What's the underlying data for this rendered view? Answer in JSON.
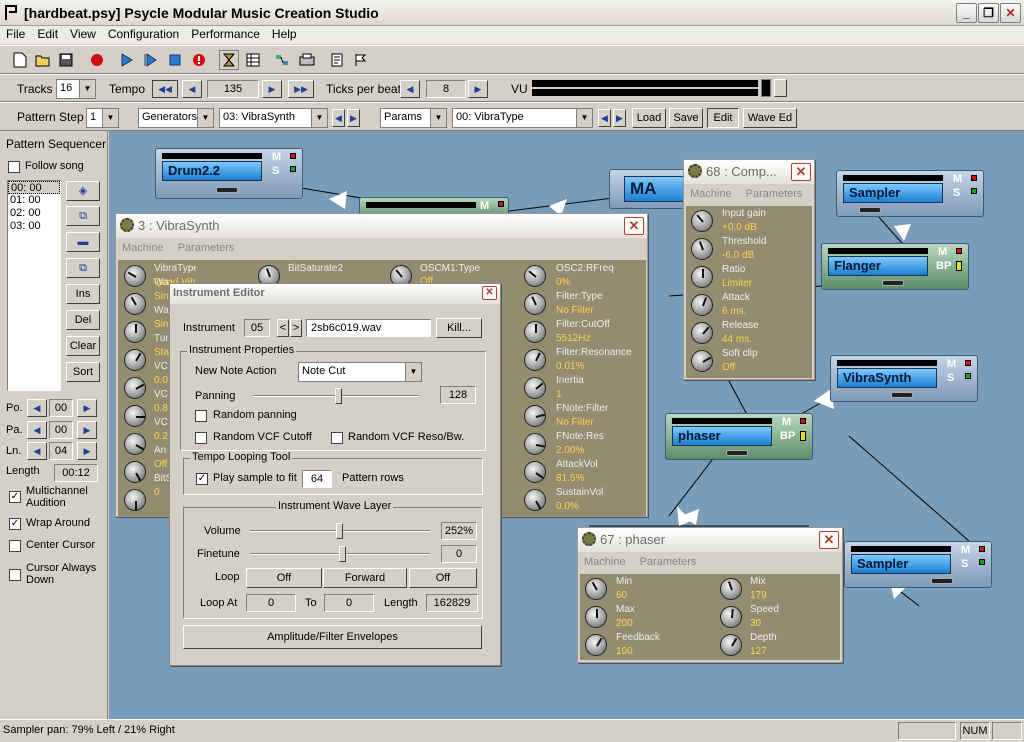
{
  "app": {
    "title": "[hardbeat.psy] Psycle Modular Music Creation Studio"
  },
  "menu": [
    "File",
    "Edit",
    "View",
    "Configuration",
    "Performance",
    "Help"
  ],
  "toolbar2": {
    "tracks_label": "Tracks",
    "tracks_value": "16",
    "tempo_label": "Tempo",
    "tempo_value": "135",
    "tpb_label": "Ticks per beat",
    "tpb_value": "8",
    "vu_label": "VU"
  },
  "toolbar3": {
    "pattern_step_label": "Pattern Step",
    "pattern_step_value": "1",
    "gen_combo": "Generators",
    "machine_combo": "03: VibraSynth",
    "params_combo": "Params",
    "param_combo": "00:  VibraType",
    "load": "Load",
    "save": "Save",
    "edit": "Edit",
    "waveed": "Wave Ed"
  },
  "sequencer": {
    "title": "Pattern Sequencer",
    "follow": "Follow song",
    "items": [
      "00: 00",
      "01: 00",
      "02: 00",
      "03: 00"
    ],
    "ins": "Ins",
    "del": "Del",
    "clear": "Clear",
    "sort": "Sort",
    "po_label": "Po.",
    "po_value": "00",
    "pa_label": "Pa.",
    "pa_value": "00",
    "ln_label": "Ln.",
    "ln_value": "04",
    "length_label": "Length",
    "length_value": "00:12",
    "multichannel": "Multichannel Audition",
    "wrap": "Wrap Around",
    "center": "Center Cursor",
    "cursor_down": "Cursor Always Down"
  },
  "machines": {
    "drum": "Drum2.2",
    "ma": "MA",
    "sampler1": "Sampler",
    "flanger": "Flanger",
    "vibrasynth": "VibraSynth",
    "phaser": "phaser",
    "sampler2": "Sampler",
    "m": "M",
    "s": "S",
    "bp": "BP"
  },
  "vibra_window": {
    "title": "3 : VibraSynth",
    "tab_machine": "Machine",
    "tab_params": "Parameters",
    "col1": [
      {
        "n": "VibraType",
        "v": "Quad Vib"
      },
      {
        "n": "Wa",
        "v": ""
      },
      {
        "n": "Sin",
        "v": ""
      },
      {
        "n": "Wa",
        "v": ""
      },
      {
        "n": "Sin",
        "v": ""
      },
      {
        "n": "Tur",
        "v": ""
      },
      {
        "n": "Sta",
        "v": ""
      },
      {
        "n": "VC",
        "v": ""
      },
      {
        "n": "0.0",
        "v": ""
      },
      {
        "n": "VC",
        "v": ""
      },
      {
        "n": "0.8",
        "v": ""
      },
      {
        "n": "VC",
        "v": ""
      },
      {
        "n": "0.2",
        "v": ""
      },
      {
        "n": "An",
        "v": ""
      },
      {
        "n": "Off",
        "v": ""
      },
      {
        "n": "BitS",
        "v": ""
      },
      {
        "n": "0",
        "v": ""
      }
    ],
    "col2_top": {
      "n": "BitSaturate2",
      "v": ""
    },
    "col3_top": {
      "n": "OSCM1:Type",
      "v": "Off"
    },
    "col4": [
      {
        "n": "OSC2:RFreq",
        "v": "0%"
      },
      {
        "n": "Filter:Type",
        "v": "No Filter"
      },
      {
        "n": "Filter:CutOff",
        "v": "5512Hz"
      },
      {
        "n": "Filter:Resonance",
        "v": "0.01%"
      },
      {
        "n": "Inertia",
        "v": "1"
      },
      {
        "n": "FNote:Filter",
        "v": "No Filter"
      },
      {
        "n": "FNote:Res",
        "v": "2.00%"
      },
      {
        "n": "AttackVol",
        "v": "81.5%"
      },
      {
        "n": "SustainVol",
        "v": "0.0%"
      }
    ]
  },
  "comp_window": {
    "title": "68 : Comp...",
    "tab_machine": "Machine",
    "tab_params": "Parameters",
    "params": [
      {
        "n": "Input gain",
        "v": "+0.0 dB"
      },
      {
        "n": "Threshold",
        "v": "-6.0 dB"
      },
      {
        "n": "Ratio",
        "v": "Limiter"
      },
      {
        "n": "Attack",
        "v": "6 ms."
      },
      {
        "n": "Release",
        "v": "44 ms."
      },
      {
        "n": "Soft clip",
        "v": "Off"
      }
    ]
  },
  "phaser_window": {
    "title": "67 : phaser",
    "tab_machine": "Machine",
    "tab_params": "Parameters",
    "left": [
      {
        "n": "Min",
        "v": "60"
      },
      {
        "n": "Max",
        "v": "200"
      },
      {
        "n": "Feedback",
        "v": "100"
      }
    ],
    "right": [
      {
        "n": "Mix",
        "v": "179"
      },
      {
        "n": "Speed",
        "v": "30"
      },
      {
        "n": "Depth",
        "v": "127"
      }
    ]
  },
  "instrument_editor": {
    "title": "Instrument Editor",
    "instrument_label": "Instrument",
    "instrument_value": "05",
    "prev": "<",
    "next": ">",
    "wave_name": "2sb6c019.wav",
    "kill": "Kill...",
    "props_title": "Instrument Properties",
    "nna_label": "New Note Action",
    "nna_value": "Note Cut",
    "panning_label": "Panning",
    "panning_value": "128",
    "random_panning": "Random panning",
    "random_vcf_cutoff": "Random VCF Cutoff",
    "random_vcf_reso": "Random VCF Reso/Bw.",
    "tempo_title": "Tempo Looping Tool",
    "play_fit": "Play sample to fit",
    "rows_value": "64",
    "rows_label": "Pattern rows",
    "wave_title": "Instrument Wave Layer",
    "volume_label": "Volume",
    "volume_value": "252%",
    "finetune_label": "Finetune",
    "finetune_value": "0",
    "loop_label": "Loop",
    "loop_off1": "Off",
    "loop_forward": "Forward",
    "loop_off2": "Off",
    "loopat_label": "Loop At",
    "loopat_value": "0",
    "to_label": "To",
    "to_value": "0",
    "length_label": "Length",
    "length_value": "162829",
    "envelopes": "Amplitude/Filter Envelopes"
  },
  "status": {
    "text": "Sampler pan: 79% Left / 21% Right",
    "num": "NUM"
  }
}
